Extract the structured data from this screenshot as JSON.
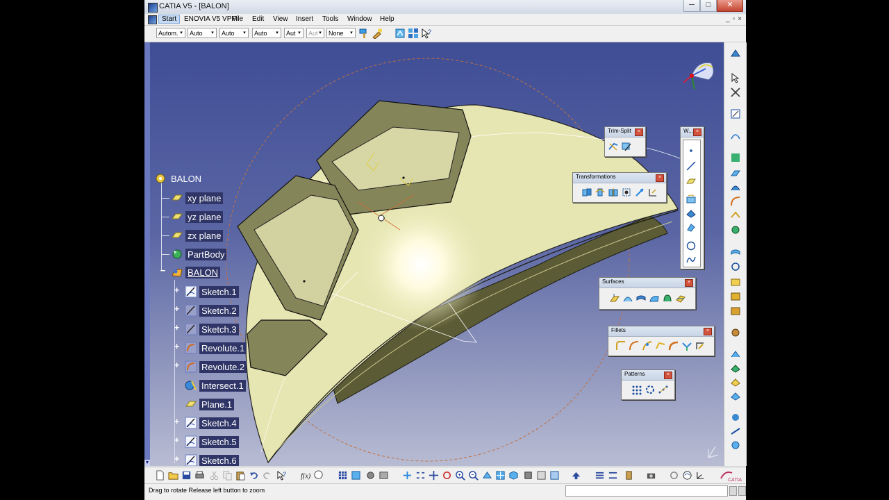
{
  "window": {
    "title": "CATIA V5 - [BALON]",
    "controls": {
      "minimize": "─",
      "maximize": "□",
      "close": "✕"
    },
    "mdi_controls": {
      "minimize": "_",
      "restore": "▫",
      "close": "×"
    }
  },
  "menubar": {
    "items": [
      "Start",
      "ENOVIA V5 VPM",
      "File",
      "Edit",
      "View",
      "Insert",
      "Tools",
      "Window",
      "Help"
    ]
  },
  "toolbar": {
    "combos": [
      {
        "value": "Autom."
      },
      {
        "value": "Auto"
      },
      {
        "value": "Auto"
      },
      {
        "value": "Auto"
      },
      {
        "value": "Aut"
      },
      {
        "value": "Aut",
        "disabled": true
      },
      {
        "value": "None"
      }
    ],
    "dropdown_arrow": "▾"
  },
  "tree": {
    "root": "BALON",
    "nodes": [
      {
        "label": "xy plane",
        "icon": "plane-icon"
      },
      {
        "label": "yz plane",
        "icon": "plane-icon"
      },
      {
        "label": "zx plane",
        "icon": "plane-icon"
      },
      {
        "label": "PartBody",
        "icon": "partbody-icon"
      },
      {
        "label": "BALON",
        "icon": "geometrical-set-icon",
        "expanded": true,
        "underline": true
      },
      {
        "label": "Sketch.1",
        "icon": "sketch-icon",
        "expandable": true
      },
      {
        "label": "Sketch.2",
        "icon": "sketch-icon",
        "expandable": true
      },
      {
        "label": "Sketch.3",
        "icon": "sketch-icon",
        "expandable": true
      },
      {
        "label": "Revolute.1",
        "icon": "revolute-icon",
        "expandable": true
      },
      {
        "label": "Revolute.2",
        "icon": "revolute-icon",
        "expandable": true
      },
      {
        "label": "Intersect.1",
        "icon": "intersect-icon"
      },
      {
        "label": "Plane.1",
        "icon": "plane-icon"
      },
      {
        "label": "Sketch.4",
        "icon": "sketch-icon",
        "expandable": true
      },
      {
        "label": "Sketch.5",
        "icon": "sketch-icon",
        "expandable": true
      },
      {
        "label": "Sketch.6",
        "icon": "sketch-icon",
        "expandable": true
      }
    ],
    "expand_symbol": "+",
    "collapse_symbol": "−"
  },
  "floating_toolbars": {
    "trim_split": {
      "title": "Trim-Split",
      "icons": [
        "split-icon",
        "trim-icon"
      ]
    },
    "transformations": {
      "title": "Transformations",
      "icons": [
        "translate-icon",
        "rotate-icon",
        "symmetry-icon",
        "scaling-icon",
        "affinity-icon",
        "axis-to-axis-icon"
      ]
    },
    "wireframe": {
      "title": "W...",
      "icons": [
        "point-icon",
        "line-icon",
        "plane-icon",
        "projection-icon",
        "intersection-icon",
        "offset-curve-icon",
        "circle-icon",
        "spline-icon"
      ]
    },
    "surfaces": {
      "title": "Surfaces",
      "icons": [
        "extrude-icon",
        "revolve-icon",
        "offset-surface-icon",
        "sweep-icon",
        "fill-icon",
        "multi-section-surface-icon"
      ]
    },
    "fillets": {
      "title": "Fillets",
      "icons": [
        "shape-fillet-icon",
        "edge-fillet-icon",
        "variable-fillet-icon",
        "chordal-fillet-icon",
        "face-fillet-icon",
        "tritangent-fillet-icon",
        "corner-icon"
      ]
    },
    "patterns": {
      "title": "Patterns",
      "icons": [
        "rectangular-pattern-icon",
        "circular-pattern-icon",
        "user-pattern-icon"
      ]
    },
    "close_symbol": "×"
  },
  "statusbar": {
    "message": "Drag to rotate  Release left button to zoom"
  },
  "colors": {
    "viewport_top": "#3f4d95",
    "viewport_bottom": "#b8bcd3",
    "part_surface": "#e8e8b4",
    "part_edge": "#1a1a10",
    "tree_label_bg": "#2f3566"
  }
}
